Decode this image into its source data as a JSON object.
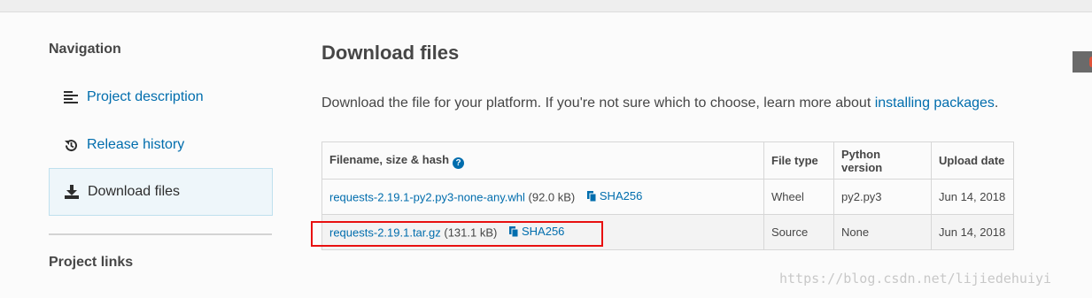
{
  "sidebar": {
    "heading": "Navigation",
    "items": [
      {
        "label": "Project description",
        "icon": "list-icon",
        "active": false
      },
      {
        "label": "Release history",
        "icon": "history-icon",
        "active": false
      },
      {
        "label": "Download files",
        "icon": "download-icon",
        "active": true
      }
    ],
    "links_heading": "Project links"
  },
  "main": {
    "title": "Download files",
    "intro_text": "Download the file for your platform. If you're not sure which to choose, learn more about ",
    "intro_link": "installing packages",
    "intro_end": "."
  },
  "table": {
    "headers": [
      "Filename, size & hash",
      "File type",
      "Python version",
      "Upload date"
    ],
    "rows": [
      {
        "filename": "requests-2.19.1-py2.py3-none-any.whl",
        "size": "(92.0 kB)",
        "hash": "SHA256",
        "type": "Wheel",
        "python": "py2.py3",
        "date": "Jun 14, 2018"
      },
      {
        "filename": "requests-2.19.1.tar.gz",
        "size": "(131.1 kB)",
        "hash": "SHA256",
        "type": "Source",
        "python": "None",
        "date": "Jun 14, 2018"
      }
    ]
  },
  "watermark": "https://blog.csdn.net/lijiedehuiyi",
  "colors": {
    "link": "#006dad",
    "highlight": "#e81010"
  }
}
